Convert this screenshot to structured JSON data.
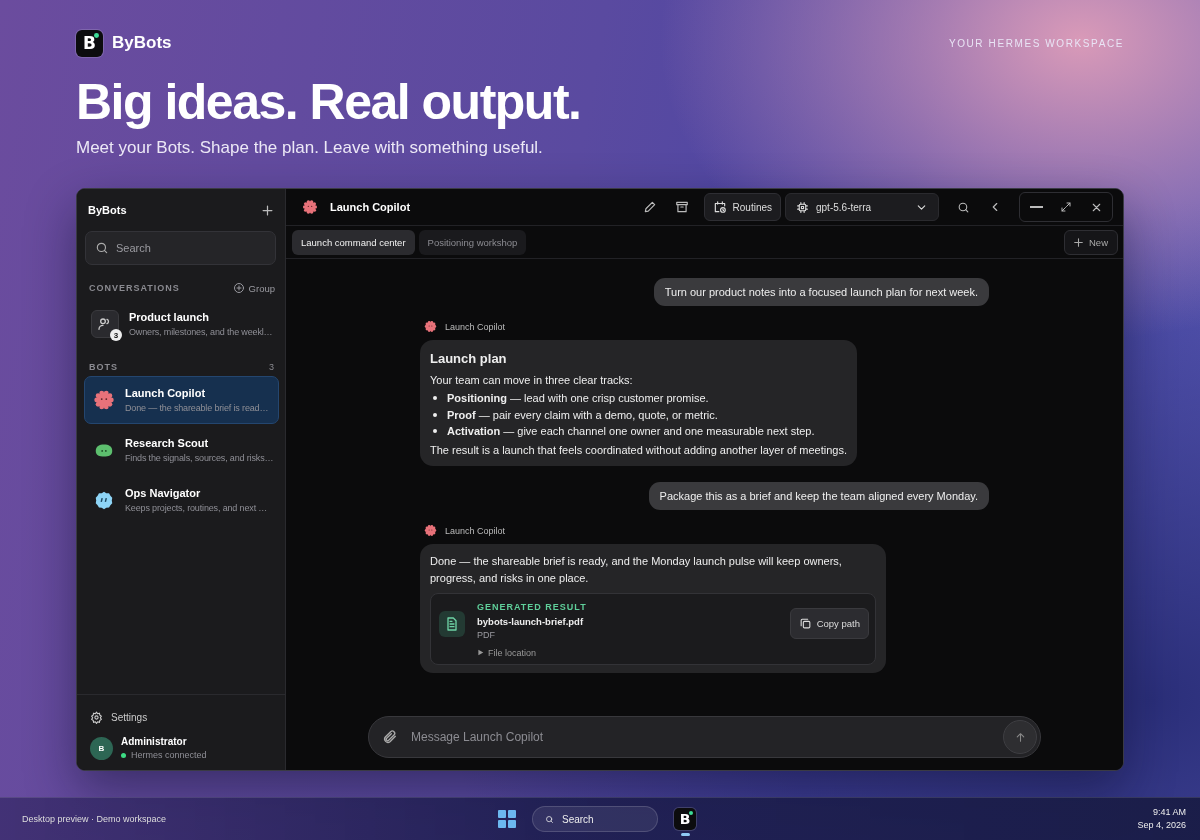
{
  "brand": {
    "logo_letter": "B",
    "name": "ByBots",
    "tagline": "YOUR HERMES WORKSPACE"
  },
  "hero": {
    "title": "Big ideas. Real output.",
    "subtitle": "Meet your Bots. Shape the plan. Leave with something useful."
  },
  "app": {
    "sidebar": {
      "title": "ByBots",
      "search": {
        "placeholder": "Search"
      },
      "conversations": {
        "heading": "CONVERSATIONS",
        "action": "Group",
        "items": [
          {
            "title": "Product launch",
            "preview": "Owners, milestones, and the weekl…",
            "badge": "3",
            "selected": false
          }
        ]
      },
      "bots": {
        "heading": "BOTS",
        "count": "3",
        "items": [
          {
            "name": "Launch Copilot",
            "preview": "Done — the shareable brief is read…",
            "kind": "spiky",
            "color": "#e8727a",
            "selected": true
          },
          {
            "name": "Research Scout",
            "preview": "Finds the signals, sources, and risks…",
            "kind": "blob",
            "color": "#5dbf6e",
            "selected": false
          },
          {
            "name": "Ops Navigator",
            "preview": "Keeps projects, routines, and next …",
            "kind": "bubble",
            "color": "#8ed4f6",
            "selected": false
          }
        ]
      },
      "settings": "Settings",
      "user": {
        "initial": "B",
        "name": "Administrator",
        "status": "Hermes connected",
        "online": true
      }
    },
    "header": {
      "title": "Launch Copilot",
      "routines": "Routines",
      "model": "gpt-5.6-terra"
    },
    "tabs": [
      {
        "label": "Launch command center",
        "selected": true
      },
      {
        "label": "Positioning workshop",
        "selected": false
      }
    ],
    "new_button": "New",
    "messages": [
      {
        "kind": "user",
        "text": "Turn our product notes into a focused launch plan for next week."
      },
      {
        "kind": "bot",
        "sender": "Launch Copilot",
        "heading": "Launch plan",
        "intro": "Your team can move in three clear tracks:",
        "bullets": [
          "**Positioning** — lead with one crisp customer promise.",
          "**Proof** — pair every claim with a demo, quote, or metric.",
          "**Activation** — give each channel one owner and one measurable next step."
        ],
        "outro": "The result is a launch that feels coordinated without adding another layer of meetings."
      },
      {
        "kind": "user",
        "text": "Package this as a brief and keep the team aligned every Monday."
      },
      {
        "kind": "bot",
        "sender": "Launch Copilot",
        "text": "Done — the shareable brief is ready, and the Monday launch pulse will keep owners, progress, and risks in one place.",
        "attachment": {
          "label": "GENERATED RESULT",
          "filename": "bybots-launch-brief.pdf",
          "type": "PDF",
          "details": "File location",
          "action": "Copy path"
        }
      }
    ],
    "composer": {
      "placeholder": "Message Launch Copilot"
    }
  },
  "taskbar": {
    "caption": "Desktop preview · Demo workspace",
    "search": "Search",
    "app_letter": "B",
    "app_running": true,
    "time": "9:41 AM",
    "date": "Sep 4, 2026"
  }
}
